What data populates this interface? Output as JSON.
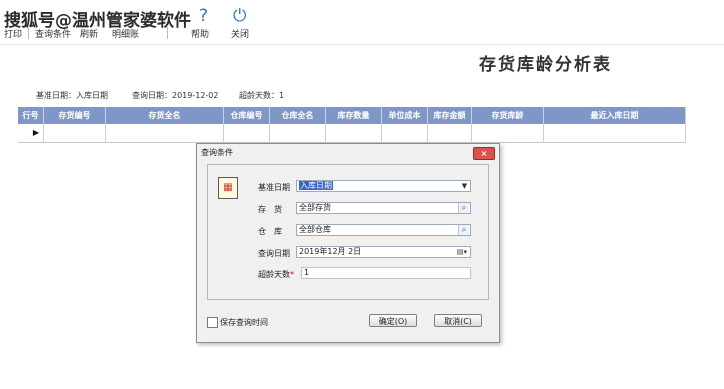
{
  "watermark": "搜狐号@温州管家婆软件",
  "toolbar": {
    "help_icon": "?",
    "power_icon": "⏻",
    "items": [
      "打印",
      "查询条件",
      "刷新",
      "明细账",
      "帮助",
      "关闭"
    ]
  },
  "report": {
    "title": "存货库龄分析表",
    "info": {
      "base_date": "基准日期：入库日期",
      "query_date": "查询日期：2019-12-02",
      "overdue_days": "超龄天数：1"
    }
  },
  "grid": {
    "columns": [
      "行号",
      "存货编号",
      "存货全名",
      "仓库编号",
      "仓库全名",
      "库存数量",
      "单位成本",
      "库存金额",
      "存货库龄",
      "最近入库日期"
    ],
    "row_indicator": "▶"
  },
  "dialog": {
    "title": "查询条件",
    "close": "×",
    "fields": {
      "base_date": {
        "label": "基准日期",
        "value": "入库日期"
      },
      "inventory": {
        "label": "存　货",
        "value": "全部存货"
      },
      "warehouse": {
        "label": "仓　库",
        "value": "全部仓库"
      },
      "query_date": {
        "label": "查询日期",
        "value": "2019年12月 2日"
      },
      "overdue_days": {
        "label": "超龄天数",
        "required_mark": "*",
        "value": "1"
      }
    },
    "save_query_time": "保存查询时间",
    "ok": "确定(O)",
    "cancel": "取消(C)"
  },
  "colors": {
    "header_bg": "#7f97c7",
    "selection": "#3a62c9",
    "close_btn": "#d9534f"
  }
}
